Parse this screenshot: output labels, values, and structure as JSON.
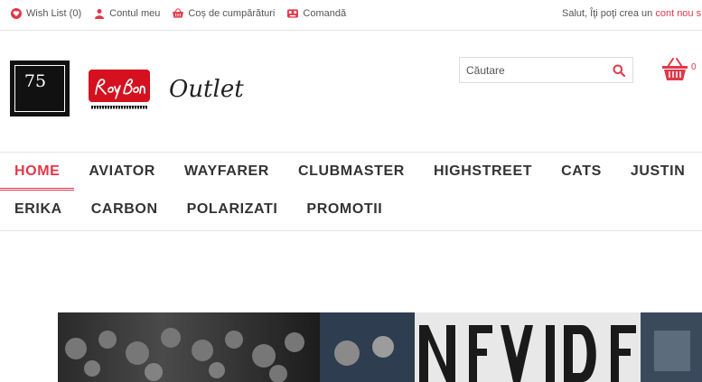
{
  "topbar": {
    "links": [
      {
        "label": "Wish List (0)",
        "icon": "heart-icon"
      },
      {
        "label": "Contul meu",
        "icon": "user-icon"
      },
      {
        "label": "Coș de cumpărături",
        "icon": "basket-icon"
      },
      {
        "label": "Comandă",
        "icon": "order-icon"
      }
    ],
    "welcome_text": "Salut, Îţi poţi crea un ",
    "welcome_link": "cont nou s"
  },
  "logo": {
    "number": "75",
    "brand_text": "Outlet",
    "rayban_script": "Ray-Ban",
    "rayban_tagline": "GENUINE SINCE 1937"
  },
  "search": {
    "placeholder": "Căutare"
  },
  "cart": {
    "count": "0"
  },
  "nav": {
    "row1": [
      "HOME",
      "AVIATOR",
      "WAYFARER",
      "CLUBMASTER",
      "HIGHSTREET",
      "CATS",
      "JUSTIN"
    ],
    "row2": [
      "ERIKA",
      "CARBON",
      "POLARIZATI",
      "PROMOTII"
    ]
  },
  "colors": {
    "accent": "#e0394a",
    "text": "#333333",
    "border": "#e5e5e5"
  }
}
